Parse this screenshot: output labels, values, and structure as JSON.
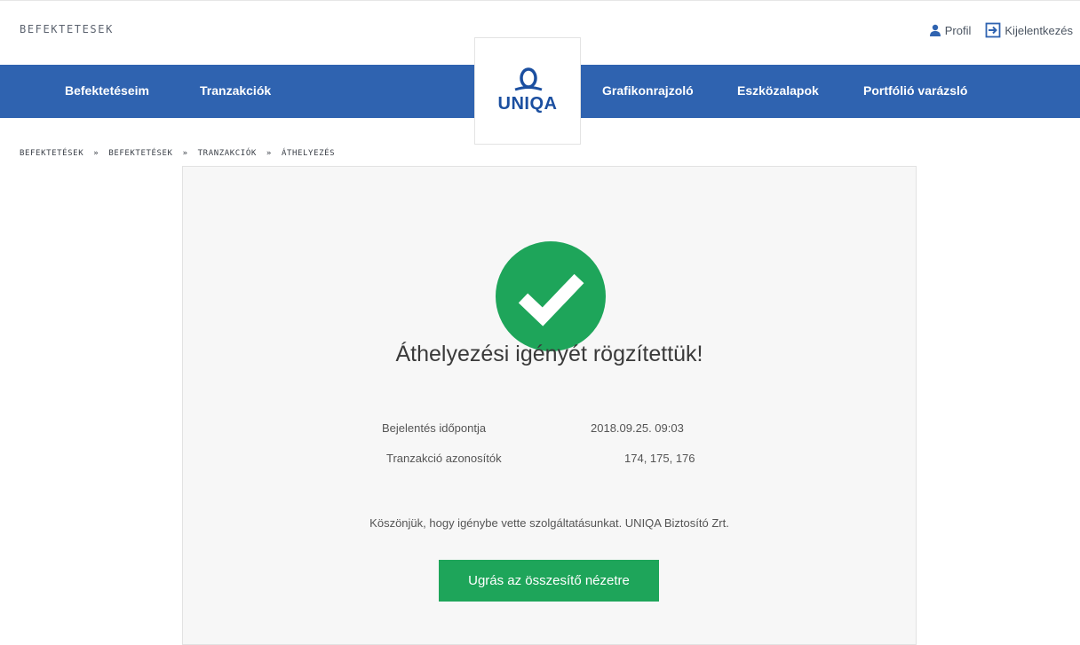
{
  "header": {
    "brand_text": "BEFEKTETESEK",
    "profile_label": "Profil",
    "logout_label": "Kijelentkezés"
  },
  "nav": {
    "items": [
      {
        "label": "Befektetéseim"
      },
      {
        "label": "Tranzakciók"
      },
      {
        "label": "Grafikonrajzoló"
      },
      {
        "label": "Eszközalapok"
      },
      {
        "label": "Portfólió varázsló"
      }
    ],
    "background_color": "#2f63b0"
  },
  "logo": {
    "text": "UNIQA",
    "color": "#1b4fa0"
  },
  "breadcrumb": {
    "items": [
      "BEFEKTETÉSEK",
      "BEFEKTETÉSEK",
      "TRANZAKCIÓK",
      "ÁTHELYEZÉS"
    ],
    "separator": "»"
  },
  "result": {
    "status_icon": "check-circle-icon",
    "status_color": "#1ea55a",
    "title": "Áthelyezési igényét rögzítettük!",
    "details": [
      {
        "label": "Bejelentés időpontja",
        "value": "2018.09.25. 09:03"
      },
      {
        "label": "Tranzakció azonosítók",
        "value": "174, 175, 176"
      }
    ],
    "thanks": "Köszönjük, hogy igénybe vette szolgáltatásunkat. UNIQA Biztosító Zrt.",
    "button_label": "Ugrás az összesítő nézetre"
  }
}
